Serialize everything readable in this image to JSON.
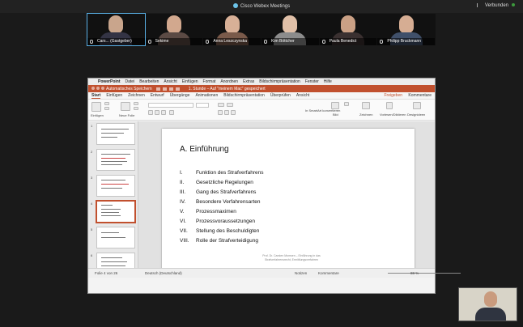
{
  "webex": {
    "title": "Cisco Webex Meetings",
    "status": "Verbunden",
    "participants": [
      {
        "name": "Cars... (Gastgeber)",
        "active": true
      },
      {
        "name": "Sekime",
        "active": false
      },
      {
        "name": "Anna Leszczynska",
        "active": false
      },
      {
        "name": "Kim Böttcher",
        "active": false
      },
      {
        "name": "Paula Benedict",
        "active": false
      },
      {
        "name": "Philipp Bruckmann",
        "active": false
      }
    ]
  },
  "ppt": {
    "app_name": "PowerPoint",
    "menu": [
      "Datei",
      "Bearbeiten",
      "Ansicht",
      "Einfügen",
      "Format",
      "Anordnen",
      "Extras",
      "Bildschirmpräsentation",
      "Fenster",
      "Hilfe"
    ],
    "autosave_label": "Automatisches Speichern",
    "doc_title": "1. Stunde – Auf \"meinem Mac\" gespeichert",
    "tabs": [
      "Start",
      "Einfügen",
      "Zeichnen",
      "Entwurf",
      "Übergänge",
      "Animationen",
      "Bildschirmpräsentation",
      "Überprüfen",
      "Ansicht"
    ],
    "share_label": "Freigeben",
    "comments_label": "Kommentare",
    "ribbon": {
      "paste_label": "Einfügen",
      "new_slide_label": "Neue Folie",
      "convert_label": "In SmartArt konvertieren",
      "image_label": "Bild",
      "draw_label": "Zeichnen",
      "dictate_label": "Vorlesen/Diktieren",
      "design_label": "Designideen"
    },
    "thumbnails": [
      "1",
      "2",
      "3",
      "4",
      "5",
      "6"
    ],
    "selected_slide": 4,
    "slide": {
      "title": "A. Einführung",
      "items": [
        {
          "num": "I.",
          "text": "Funktion des Strafverfahrens"
        },
        {
          "num": "II.",
          "text": "Gesetzliche Regelungen"
        },
        {
          "num": "III.",
          "text": "Gang des Strafverfahrens"
        },
        {
          "num": "IV.",
          "text": "Besondere Verfahrensarten"
        },
        {
          "num": "V.",
          "text": "Prozessmaximen"
        },
        {
          "num": "VI.",
          "text": "Prozessvoraussetzungen"
        },
        {
          "num": "VII.",
          "text": "Stellung des Beschuldigten"
        },
        {
          "num": "VIII.",
          "text": "Rolle der Strafverteidigung"
        }
      ],
      "footer_line1": "Prof. Dr. Carsten Momsen – Einführung in das",
      "footer_line2": "Strafverfahrensrecht, Ermittlungsverfahren"
    },
    "status": {
      "slide_of": "Folie 4 von 26",
      "language": "Deutsch (Deutschland)",
      "notes": "Notizen",
      "comments": "Kommentare",
      "zoom": "88 %"
    }
  }
}
